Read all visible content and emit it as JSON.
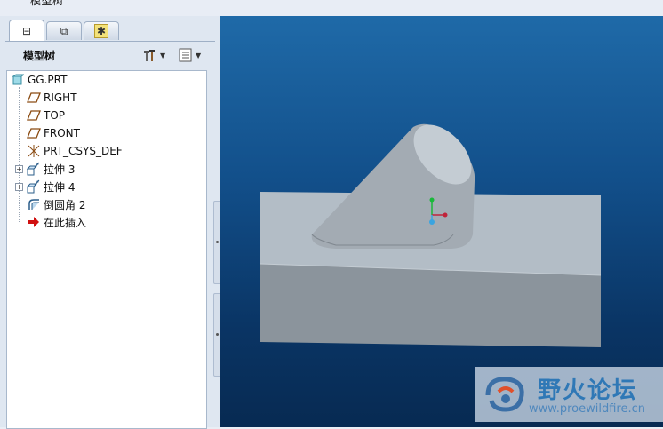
{
  "top": {
    "title_fragment": "模型树"
  },
  "left": {
    "tabs": [
      {
        "name": "model-tree-tab",
        "glyph": "⊟"
      },
      {
        "name": "folder-browser-tab",
        "glyph": "⧉"
      },
      {
        "name": "favorites-tab",
        "glyph": "✱"
      }
    ],
    "title": "模型树",
    "tools": {
      "settings_arrow": "▼",
      "show_arrow": "▼"
    },
    "tree": [
      {
        "label": "GG.PRT",
        "icon": "part-icon"
      },
      {
        "label": "RIGHT",
        "icon": "datum-plane-icon"
      },
      {
        "label": "TOP",
        "icon": "datum-plane-icon"
      },
      {
        "label": "FRONT",
        "icon": "datum-plane-icon"
      },
      {
        "label": "PRT_CSYS_DEF",
        "icon": "coordinate-system-icon"
      },
      {
        "label": "拉伸 3",
        "icon": "extrude-icon"
      },
      {
        "label": "拉伸 4",
        "icon": "extrude-icon"
      },
      {
        "label": "倒圆角 2",
        "icon": "round-icon"
      },
      {
        "label": "在此插入",
        "icon": "insert-here-arrow-icon"
      }
    ]
  },
  "watermark": {
    "title": "野火论坛",
    "url": "www.proewildfire.cn"
  },
  "colors": {
    "viewport_top": "#1f6aa8",
    "viewport_bottom": "#072a52",
    "model_top": "#b3bdc6",
    "model_front": "#8b949c",
    "insert_arrow": "#d01010"
  }
}
